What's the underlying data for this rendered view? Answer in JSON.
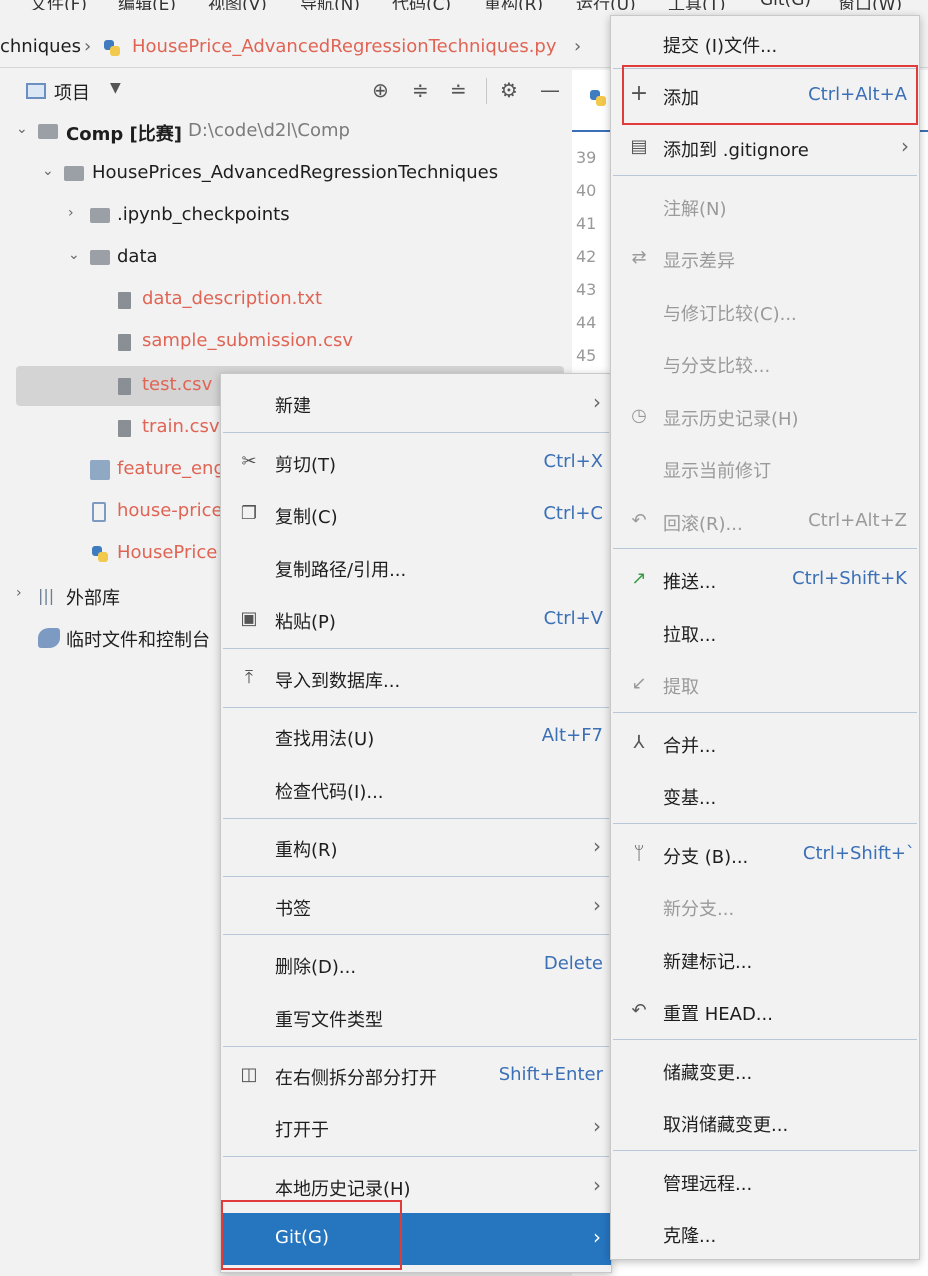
{
  "menubar": [
    "文件(F)",
    "编辑(E)",
    "视图(V)",
    "导航(N)",
    "代码(C)",
    "重构(R)",
    "运行(U)",
    "工具(T)",
    "Git(G)",
    "窗口(W)"
  ],
  "breadcrumb": {
    "folder": "chniques",
    "file": "HousePrice_AdvancedRegressionTechniques.py"
  },
  "project": {
    "title": "项目",
    "tree": [
      {
        "label": "Comp [比赛]",
        "path": "D:\\code\\d2l\\Comp"
      },
      {
        "label": "HousePrices_AdvancedRegressionTechniques"
      },
      {
        "label": ".ipynb_checkpoints"
      },
      {
        "label": "data"
      },
      {
        "label": "data_description.txt"
      },
      {
        "label": "sample_submission.csv"
      },
      {
        "label": "test.csv"
      },
      {
        "label": "train.csv"
      },
      {
        "label": "feature_eng"
      },
      {
        "label": "house-price"
      },
      {
        "label": "HousePrice"
      },
      {
        "label": "外部库"
      },
      {
        "label": "临时文件和控制台"
      }
    ]
  },
  "editor": {
    "lines": [
      "39",
      "40",
      "41",
      "42",
      "43",
      "44",
      "45"
    ]
  },
  "context_menu": {
    "items": [
      {
        "label": "新建"
      },
      {
        "label": "剪切(T)",
        "shortcut": "Ctrl+X"
      },
      {
        "label": "复制(C)",
        "shortcut": "Ctrl+C"
      },
      {
        "label": "复制路径/引用..."
      },
      {
        "label": "粘贴(P)",
        "shortcut": "Ctrl+V"
      },
      {
        "label": "导入到数据库..."
      },
      {
        "label": "查找用法(U)",
        "shortcut": "Alt+F7"
      },
      {
        "label": "检查代码(I)..."
      },
      {
        "label": "重构(R)"
      },
      {
        "label": "书签"
      },
      {
        "label": "删除(D)...",
        "shortcut": "Delete"
      },
      {
        "label": "重写文件类型"
      },
      {
        "label": "在右侧拆分部分打开",
        "shortcut": "Shift+Enter"
      },
      {
        "label": "打开于"
      },
      {
        "label": "本地历史记录(H)"
      },
      {
        "label": "Git(G)"
      }
    ]
  },
  "git_menu": {
    "items": [
      {
        "label": "提交 (I)文件..."
      },
      {
        "label": "添加",
        "shortcut": "Ctrl+Alt+A"
      },
      {
        "label": "添加到 .gitignore"
      },
      {
        "label": "注解(N)"
      },
      {
        "label": "显示差异"
      },
      {
        "label": "与修订比较(C)..."
      },
      {
        "label": "与分支比较..."
      },
      {
        "label": "显示历史记录(H)"
      },
      {
        "label": "显示当前修订"
      },
      {
        "label": "回滚(R)...",
        "shortcut": "Ctrl+Alt+Z"
      },
      {
        "label": "推送...",
        "shortcut": "Ctrl+Shift+K"
      },
      {
        "label": "拉取..."
      },
      {
        "label": "提取"
      },
      {
        "label": "合并..."
      },
      {
        "label": "变基..."
      },
      {
        "label": "分支 (B)...",
        "shortcut": "Ctrl+Shift+`"
      },
      {
        "label": "新分支..."
      },
      {
        "label": "新建标记..."
      },
      {
        "label": "重置 HEAD..."
      },
      {
        "label": "储藏变更..."
      },
      {
        "label": "取消储藏变更..."
      },
      {
        "label": "管理远程..."
      },
      {
        "label": "克隆..."
      }
    ]
  }
}
